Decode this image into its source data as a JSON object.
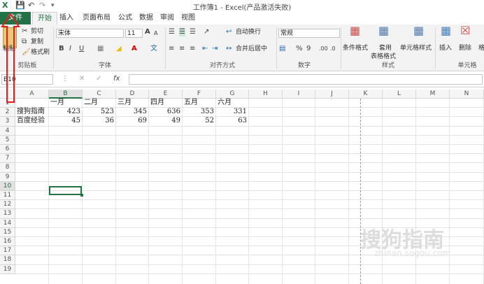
{
  "app": {
    "window_title": "工作簿1 - Excel(产品激活失败)",
    "accent": "#217346",
    "annotation_color": "#e02020"
  },
  "tabs": [
    {
      "label": "文件"
    },
    {
      "label": "开始"
    },
    {
      "label": "插入"
    },
    {
      "label": "页面布局"
    },
    {
      "label": "公式"
    },
    {
      "label": "数据"
    },
    {
      "label": "审阅"
    },
    {
      "label": "视图"
    }
  ],
  "ribbon": {
    "clipboard": {
      "label": "剪贴板",
      "paste": "粘贴",
      "cut": "剪切",
      "copy": "复制",
      "format_painter": "格式刷"
    },
    "font": {
      "label": "字体",
      "name": "宋体",
      "size": "11",
      "bold": "B",
      "italic": "I",
      "underline": "U",
      "grow": "A",
      "shrink": "A"
    },
    "alignment": {
      "label": "对齐方式",
      "wrap": "自动换行",
      "merge": "合并后居中"
    },
    "number": {
      "label": "数字",
      "format": "常规",
      "percent": "%",
      "comma": "9"
    },
    "styles": {
      "label": "样式",
      "conditional": "条件格式",
      "table": "套用",
      "table2": "表格格式",
      "cell_styles": "单元格样式"
    },
    "cells": {
      "label": "单元格",
      "insert": "插入",
      "delete": "删除",
      "format": "格"
    }
  },
  "formula_bar": {
    "name_box": "B10",
    "fx": "fx",
    "value": ""
  },
  "sheet": {
    "columns": [
      "A",
      "B",
      "C",
      "D",
      "E",
      "F",
      "G",
      "H",
      "I",
      "J",
      "K",
      "L",
      "M",
      "N"
    ],
    "rows": [
      "1",
      "2",
      "3",
      "4",
      "5",
      "6",
      "7",
      "8",
      "9",
      "10",
      "11",
      "12",
      "13",
      "14",
      "15",
      "16",
      "17",
      "18",
      "19"
    ],
    "header_row": [
      "",
      "一月",
      "二月",
      "三月",
      "四月",
      "五月",
      "六月"
    ],
    "data_rows": [
      {
        "label": "搜狗指南",
        "values": [
          "423",
          "523",
          "345",
          "636",
          "353",
          "331"
        ]
      },
      {
        "label": "百度经验",
        "values": [
          "45",
          "36",
          "69",
          "49",
          "52",
          "63"
        ]
      }
    ],
    "selected_cell": "B10"
  },
  "watermark": {
    "brand": "搜狗指南",
    "url": "zhinan.sogou.com"
  }
}
